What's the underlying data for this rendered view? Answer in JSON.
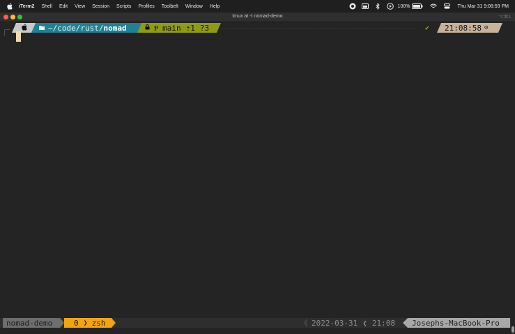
{
  "menubar": {
    "app_name": "iTerm2",
    "items": [
      "Shell",
      "Edit",
      "View",
      "Session",
      "Scripts",
      "Profiles",
      "Toolbelt",
      "Window",
      "Help"
    ],
    "battery_percent": "100%",
    "datetime": "Thu Mar 31  9:08:59 PM"
  },
  "window": {
    "title": "tmux at -t nomad-demo",
    "shortcut": "⌥⌘1"
  },
  "prompt": {
    "os_icon": "apple-icon",
    "dir_prefix": "~/code/rust/",
    "dir_current": "nomad",
    "git_icon": "lock-icon",
    "git_branch_glyph": "Ᵽ",
    "git_branch": "main",
    "git_ahead": "⇡1",
    "git_untracked": "?3",
    "status_ok": "✔",
    "time": "21:08:58",
    "clock_icon": "⊙"
  },
  "tmux": {
    "session_name": "nomad-demo",
    "window_index": "0",
    "window_name": "zsh",
    "date": "2022-03-31",
    "time": "21:08",
    "hostname": "Josephs-MacBook-Pro"
  },
  "colors": {
    "dir_segment": "#1f8193",
    "git_segment": "#8f9b14",
    "time_segment": "#c7b29a",
    "tmux_window": "#f2a413",
    "cursor": "#f0dcaa"
  }
}
